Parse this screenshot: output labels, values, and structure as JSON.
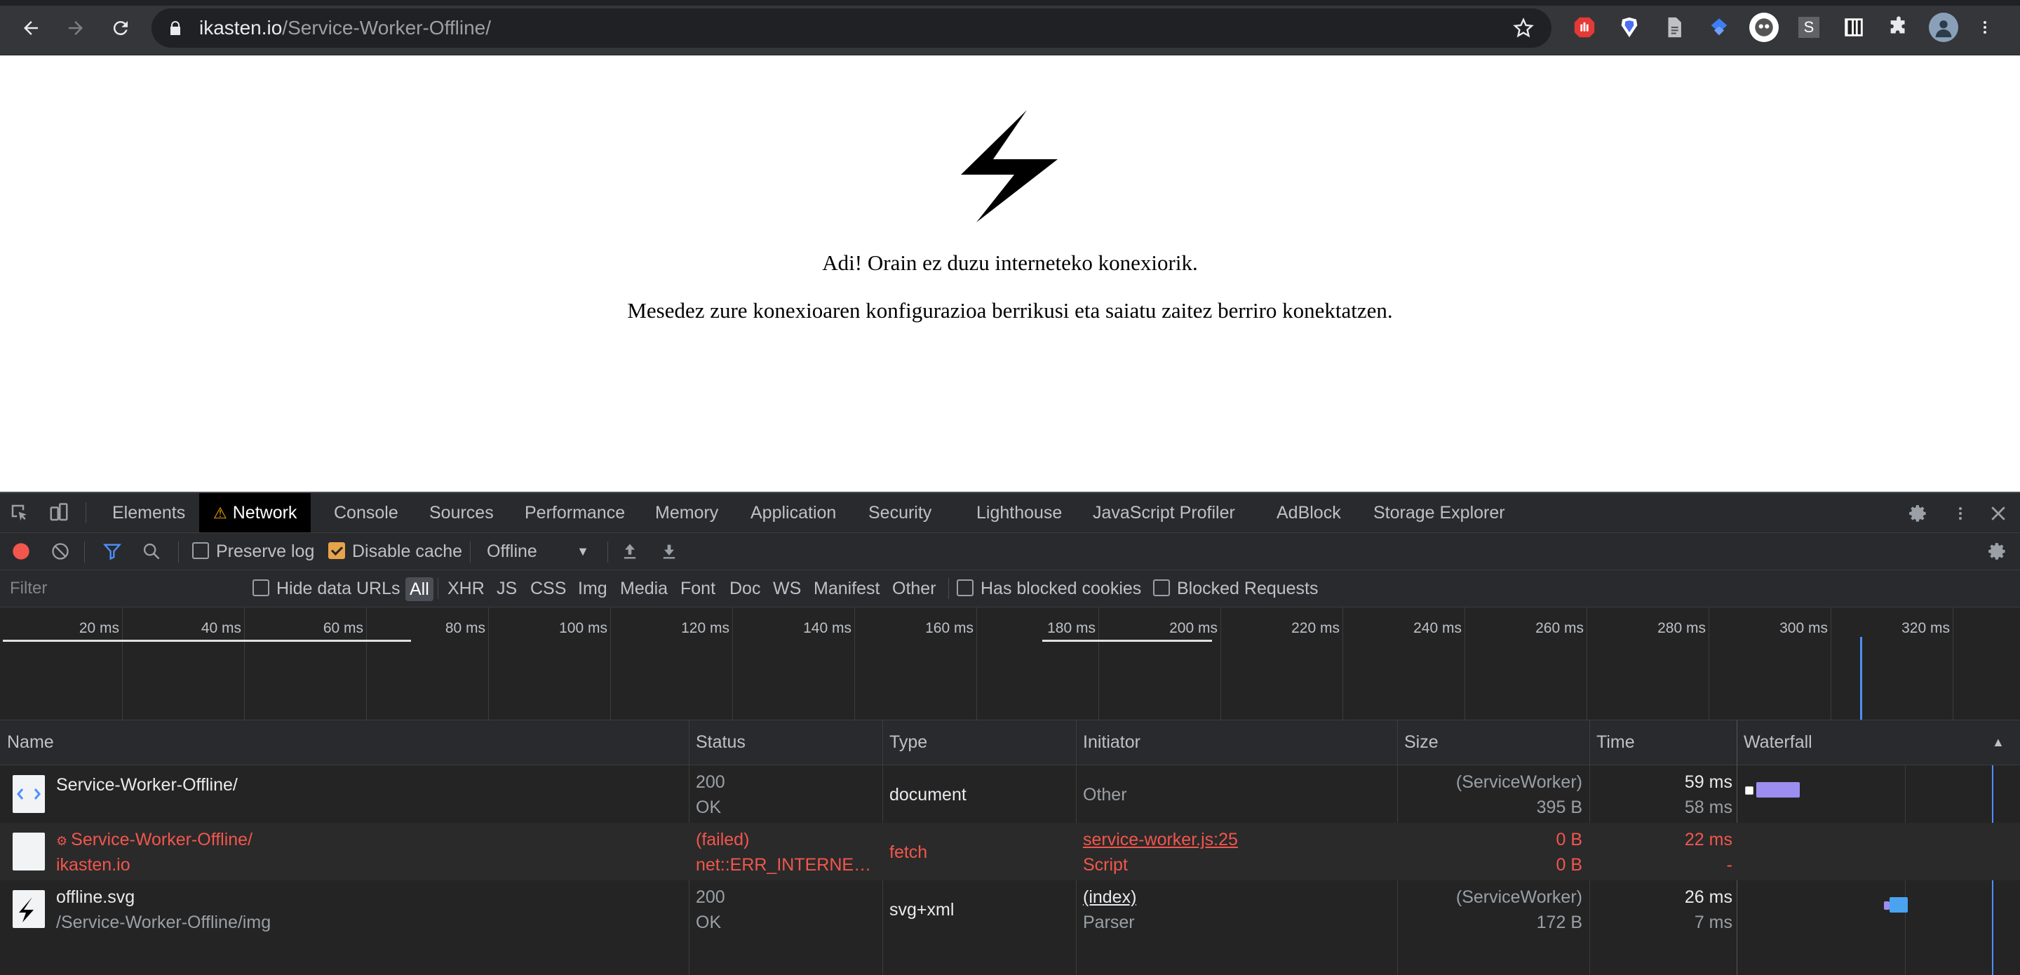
{
  "browser": {
    "url_host": "ikasten.io",
    "url_path": "/Service-Worker-Offline/",
    "extensions": [
      "adblock-icon",
      "brave-shield-icon",
      "document-extension-icon",
      "bookmark-extension-icon",
      "ghost-extension-icon",
      "s-extension-icon",
      "storage-extension-icon",
      "puzzle-icon",
      "avatar"
    ],
    "s_extension_letter": "S"
  },
  "page": {
    "message1": "Adi! Orain ez duzu interneteko konexiorik.",
    "message2": "Mesedez zure konexioaren konfigurazioa berrikusi eta saiatu zaitez berriro konektatzen."
  },
  "devtools": {
    "tabs": [
      "Elements",
      "Network",
      "Console",
      "Sources",
      "Performance",
      "Memory",
      "Application",
      "Security",
      "Lighthouse",
      "JavaScript Profiler",
      "AdBlock",
      "Storage Explorer"
    ],
    "active_tab": "Network",
    "toolbar": {
      "preserve_log": "Preserve log",
      "disable_cache": "Disable cache",
      "throttling": "Offline"
    },
    "filter": {
      "placeholder": "Filter",
      "hide_data_urls": "Hide data URLs",
      "types": [
        "All",
        "XHR",
        "JS",
        "CSS",
        "Img",
        "Media",
        "Font",
        "Doc",
        "WS",
        "Manifest",
        "Other"
      ],
      "has_blocked_cookies": "Has blocked cookies",
      "blocked_requests": "Blocked Requests"
    },
    "overview_ticks": [
      "20 ms",
      "40 ms",
      "60 ms",
      "80 ms",
      "100 ms",
      "120 ms",
      "140 ms",
      "160 ms",
      "180 ms",
      "200 ms",
      "220 ms",
      "240 ms",
      "260 ms",
      "280 ms",
      "300 ms",
      "320 ms"
    ],
    "columns": [
      "Name",
      "Status",
      "Type",
      "Initiator",
      "Size",
      "Time",
      "Waterfall"
    ],
    "rows": [
      {
        "name": "Service-Worker-Offline/",
        "path": "",
        "status": "200",
        "status_text": "OK",
        "type": "document",
        "initiator": "Other",
        "initiator_sub": "",
        "size": "(ServiceWorker)",
        "size_sub": "395 B",
        "time": "59 ms",
        "time_sub": "58 ms",
        "failed": false
      },
      {
        "name": "Service-Worker-Offline/",
        "path": "ikasten.io",
        "status": "(failed)",
        "status_text": "net::ERR_INTERNET_DISCONNECTED",
        "type": "fetch",
        "initiator": "service-worker.js:25",
        "initiator_sub": "Script",
        "size": "0 B",
        "size_sub": "0 B",
        "time": "22 ms",
        "time_sub": "-",
        "failed": true
      },
      {
        "name": "offline.svg",
        "path": "/Service-Worker-Offline/img",
        "status": "200",
        "status_text": "OK",
        "type": "svg+xml",
        "initiator": "(index)",
        "initiator_sub": "Parser",
        "size": "(ServiceWorker)",
        "size_sub": "172 B",
        "time": "26 ms",
        "time_sub": "7 ms",
        "failed": false
      }
    ],
    "colors": {
      "error": "#f2564d",
      "waterfall_purple": "#9c8ef0",
      "waterfall_blue": "#4aa3f0",
      "record": "#f2564d"
    }
  }
}
